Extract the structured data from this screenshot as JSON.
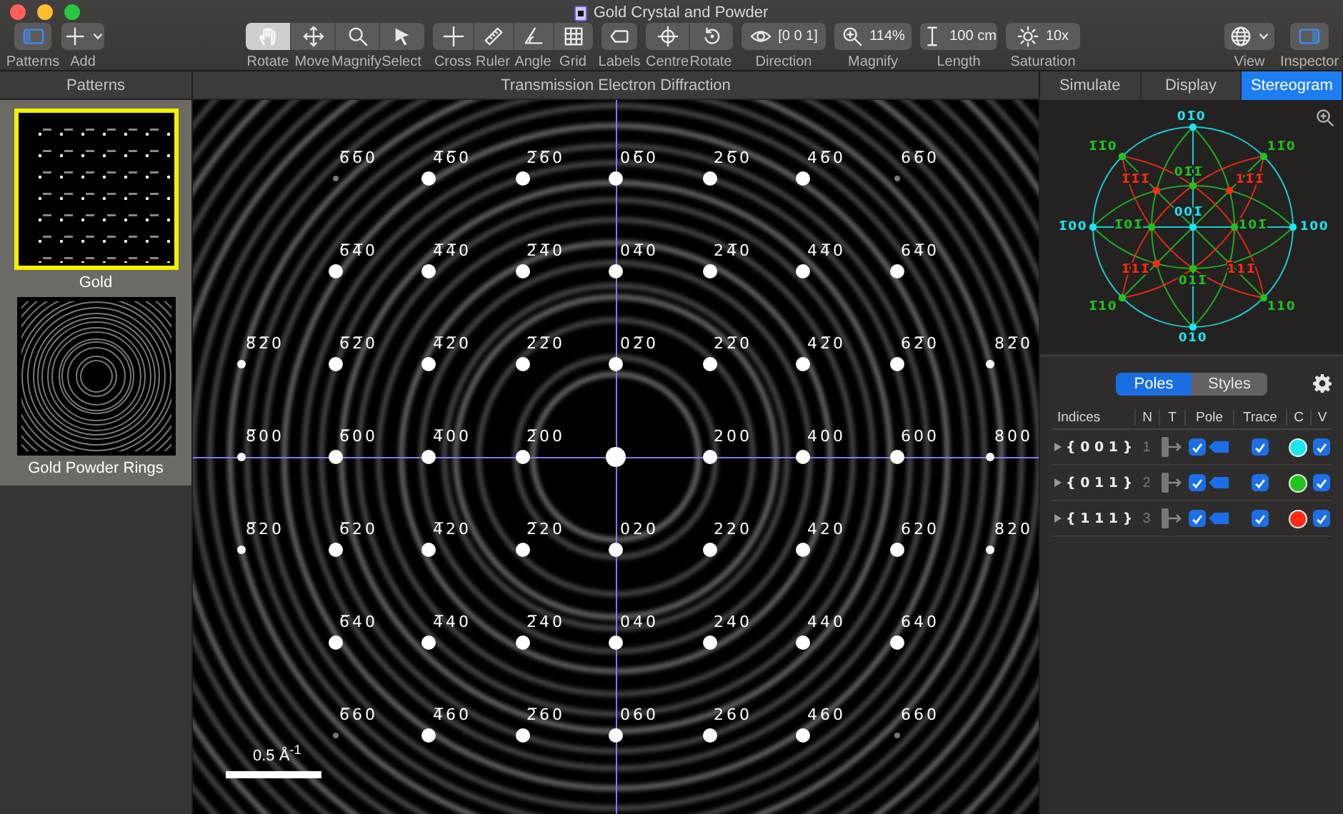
{
  "window": {
    "title": "Gold Crystal and Powder"
  },
  "toolbar": {
    "left": [
      [
        {
          "label": "Patterns",
          "on": true
        }
      ],
      [
        {
          "label": "Add",
          "kind": "menu"
        }
      ]
    ],
    "center": [
      [
        {
          "label": "Rotate",
          "selected": true
        },
        {
          "label": "Move",
          "selected": false
        },
        {
          "label": "Magnify",
          "selected": false
        },
        {
          "label": "Select",
          "selected": false
        }
      ],
      [
        {
          "label": "Cross"
        },
        {
          "label": "Ruler"
        },
        {
          "label": "Angle"
        },
        {
          "label": "Grid"
        }
      ],
      [
        {
          "label": "Labels"
        }
      ],
      [
        {
          "label": "Centre"
        },
        {
          "label": "Rotate"
        }
      ],
      [
        {
          "label": "Direction",
          "value": "[0 0 1]"
        }
      ],
      [
        {
          "label": "Magnify",
          "value": "114%"
        }
      ],
      [
        {
          "label": "Length",
          "value": "100 cm"
        }
      ],
      [
        {
          "label": "Saturation",
          "value": "10x"
        }
      ]
    ],
    "right": [
      [
        {
          "label": "View",
          "kind": "menu"
        }
      ],
      [
        {
          "label": "Inspector",
          "on": true
        }
      ]
    ]
  },
  "sidebar": {
    "title": "Patterns",
    "items": [
      {
        "name": "Gold",
        "kind": "spots",
        "selected": true
      },
      {
        "name": "Gold Powder Rings",
        "kind": "rings",
        "selected": false
      }
    ]
  },
  "viewer": {
    "title": "Transmission Electron Diffraction",
    "scale_label": "0.5 Å$^{-1}$",
    "rows": [
      [
        null,
        {
          "label": "6̅6̅0",
          "kind": "faint"
        },
        {
          "label": "4̅6̅0",
          "kind": "strong"
        },
        {
          "label": "2̅6̅0",
          "kind": "strong"
        },
        {
          "label": "06̅0",
          "kind": "strong"
        },
        {
          "label": "26̅0",
          "kind": "strong"
        },
        {
          "label": "46̅0",
          "kind": "strong"
        },
        {
          "label": "66̅0",
          "kind": "faint"
        },
        null
      ],
      [
        null,
        {
          "label": "6̅4̅0",
          "kind": "strong"
        },
        {
          "label": "4̅4̅0",
          "kind": "strong"
        },
        {
          "label": "2̅4̅0",
          "kind": "strong"
        },
        {
          "label": "04̅0",
          "kind": "strong"
        },
        {
          "label": "24̅0",
          "kind": "strong"
        },
        {
          "label": "44̅0",
          "kind": "strong"
        },
        {
          "label": "64̅0",
          "kind": "strong"
        },
        null
      ],
      [
        {
          "label": "8̅2̅0",
          "kind": "weak"
        },
        {
          "label": "6̅2̅0",
          "kind": "strong"
        },
        {
          "label": "4̅2̅0",
          "kind": "strong"
        },
        {
          "label": "2̅2̅0",
          "kind": "strong"
        },
        {
          "label": "02̅0",
          "kind": "strong"
        },
        {
          "label": "22̅0",
          "kind": "strong"
        },
        {
          "label": "42̅0",
          "kind": "strong"
        },
        {
          "label": "62̅0",
          "kind": "strong"
        },
        {
          "label": "82̅0",
          "kind": "weak"
        }
      ],
      [
        {
          "label": "8̅00",
          "kind": "weak"
        },
        {
          "label": "6̅00",
          "kind": "strong"
        },
        {
          "label": "4̅00",
          "kind": "strong"
        },
        {
          "label": "2̅00",
          "kind": "strong"
        },
        {
          "kind": "central"
        },
        {
          "label": "200",
          "kind": "strong"
        },
        {
          "label": "400",
          "kind": "strong"
        },
        {
          "label": "600",
          "kind": "strong"
        },
        {
          "label": "800",
          "kind": "weak"
        }
      ],
      [
        {
          "label": "8̅20",
          "kind": "weak"
        },
        {
          "label": "6̅20",
          "kind": "strong"
        },
        {
          "label": "4̅20",
          "kind": "strong"
        },
        {
          "label": "2̅20",
          "kind": "strong"
        },
        {
          "label": "020",
          "kind": "strong"
        },
        {
          "label": "220",
          "kind": "strong"
        },
        {
          "label": "420",
          "kind": "strong"
        },
        {
          "label": "620",
          "kind": "strong"
        },
        {
          "label": "820",
          "kind": "weak"
        }
      ],
      [
        null,
        {
          "label": "6̅40",
          "kind": "strong"
        },
        {
          "label": "4̅40",
          "kind": "strong"
        },
        {
          "label": "2̅40",
          "kind": "strong"
        },
        {
          "label": "040",
          "kind": "strong"
        },
        {
          "label": "240",
          "kind": "strong"
        },
        {
          "label": "440",
          "kind": "strong"
        },
        {
          "label": "640",
          "kind": "strong"
        },
        null
      ],
      [
        null,
        {
          "label": "6̅60",
          "kind": "faint"
        },
        {
          "label": "4̅60",
          "kind": "strong"
        },
        {
          "label": "2̅60",
          "kind": "strong"
        },
        {
          "label": "060",
          "kind": "strong"
        },
        {
          "label": "260",
          "kind": "strong"
        },
        {
          "label": "460",
          "kind": "strong"
        },
        {
          "label": "660",
          "kind": "faint"
        },
        null
      ]
    ]
  },
  "inspector": {
    "tabs": [
      {
        "label": "Simulate",
        "selected": false
      },
      {
        "label": "Display",
        "selected": false
      },
      {
        "label": "Stereogram",
        "selected": true
      }
    ],
    "segments": [
      {
        "label": "Poles",
        "selected": true
      },
      {
        "label": "Styles",
        "selected": false
      }
    ],
    "columns": [
      "Indices",
      "N",
      "T",
      "Pole",
      "Trace",
      "C",
      "V"
    ],
    "poles": [
      {
        "indices": "{ 0 0 1 }",
        "n": "1",
        "expanded": false,
        "pole_checked": true,
        "trace_checked": true,
        "color": "#19e6f0",
        "visible": true,
        "stereogram_labels": [
          "01̅0",
          "001̅",
          "1̅00",
          "100",
          "010"
        ]
      },
      {
        "indices": "{ 0 1 1 }",
        "n": "2",
        "expanded": false,
        "pole_checked": true,
        "trace_checked": true,
        "color": "#1fc41f",
        "visible": true,
        "stereogram_labels": [
          "1̅1̅0",
          "11̅0",
          "01̅1̅",
          "1̅01̅",
          "101̅",
          "011̅",
          "1̅10",
          "110"
        ]
      },
      {
        "indices": "{ 1 1 1 }",
        "n": "3",
        "expanded": false,
        "pole_checked": true,
        "trace_checked": true,
        "color": "#ff2a10",
        "visible": true,
        "stereogram_labels": [
          "1̅1̅1̅",
          "11̅1̅",
          "1̅11̅",
          "111̅"
        ]
      }
    ]
  }
}
